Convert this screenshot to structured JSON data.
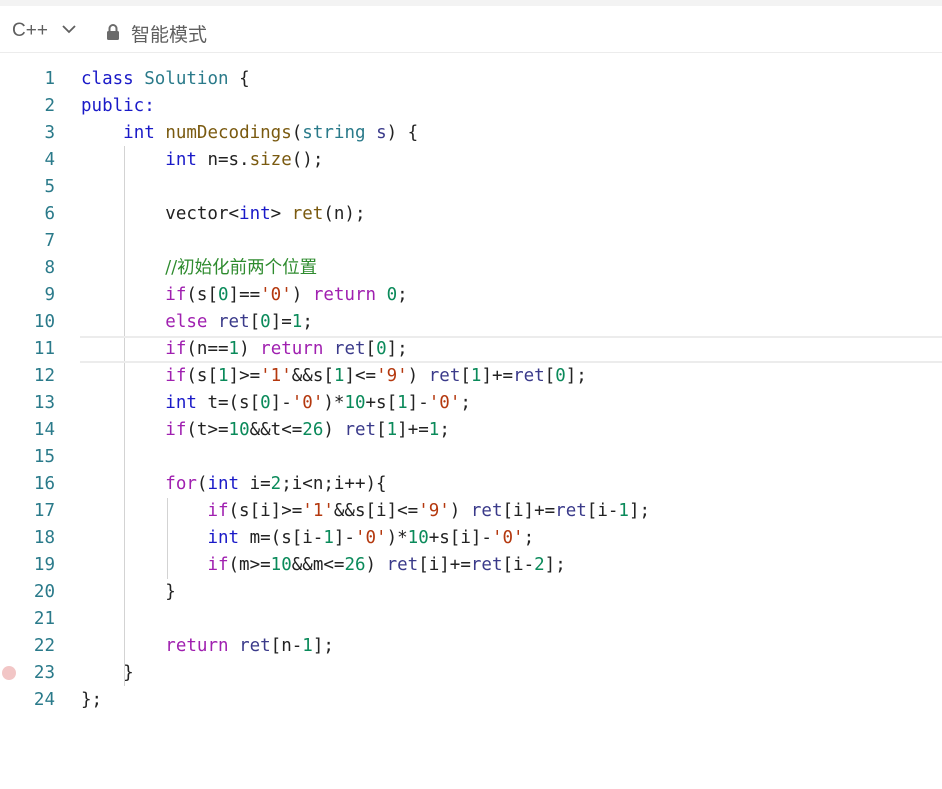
{
  "toolbar": {
    "language": "C++",
    "mode_label": "智能模式",
    "icons": {
      "lang_dropdown": "chevron-down-icon",
      "lock": "lock-icon"
    }
  },
  "editor": {
    "active_line": 11,
    "breakpoint_line": 23,
    "lines": [
      {
        "num": "1",
        "html": "<span class='k'>class</span> <span class='t'>Solution</span> {"
      },
      {
        "num": "2",
        "html": "<span class='k'>public:</span>"
      },
      {
        "num": "3",
        "html": "    <span class='k'>int</span> <span class='f'>numDecodings</span>(<span class='t'>string</span> <span class='m'>s</span>) {"
      },
      {
        "num": "4",
        "html": "        <span class='k'>int</span> n=s.<span class='f'>size</span>();"
      },
      {
        "num": "5",
        "html": ""
      },
      {
        "num": "6",
        "html": "        vector&lt;<span class='k'>int</span>&gt; <span class='f'>ret</span>(n);"
      },
      {
        "num": "7",
        "html": ""
      },
      {
        "num": "8",
        "html": "        <span class='cm'>//初始化前两个位置</span>"
      },
      {
        "num": "9",
        "html": "        <span class='c'>if</span>(s[<span class='n'>0</span>]==<span class='s'>'0'</span>) <span class='c'>return</span> <span class='n'>0</span>;"
      },
      {
        "num": "10",
        "html": "        <span class='c'>else</span> <span class='m'>ret</span>[<span class='n'>0</span>]=<span class='n'>1</span>;"
      },
      {
        "num": "11",
        "html": "        <span class='c'>if</span>(n==<span class='n'>1</span>) <span class='c'>return</span> <span class='m'>ret</span>[<span class='n'>0</span>];"
      },
      {
        "num": "12",
        "html": "        <span class='c'>if</span>(s[<span class='n'>1</span>]&gt;=<span class='s'>'1'</span>&amp;&amp;s[<span class='n'>1</span>]&lt;=<span class='s'>'9'</span>) <span class='m'>ret</span>[<span class='n'>1</span>]+=<span class='m'>ret</span>[<span class='n'>0</span>];"
      },
      {
        "num": "13",
        "html": "        <span class='k'>int</span> t=(s[<span class='n'>0</span>]-<span class='s'>'0'</span>)*<span class='n'>10</span>+s[<span class='n'>1</span>]-<span class='s'>'0'</span>;"
      },
      {
        "num": "14",
        "html": "        <span class='c'>if</span>(t&gt;=<span class='n'>10</span>&amp;&amp;t&lt;=<span class='n'>26</span>) <span class='m'>ret</span>[<span class='n'>1</span>]+=<span class='n'>1</span>;"
      },
      {
        "num": "15",
        "html": ""
      },
      {
        "num": "16",
        "html": "        <span class='c'>for</span>(<span class='k'>int</span> i=<span class='n'>2</span>;i&lt;n;i++){"
      },
      {
        "num": "17",
        "html": "            <span class='c'>if</span>(s[i]&gt;=<span class='s'>'1'</span>&amp;&amp;s[i]&lt;=<span class='s'>'9'</span>) <span class='m'>ret</span>[i]+=<span class='m'>ret</span>[i-<span class='n'>1</span>];"
      },
      {
        "num": "18",
        "html": "            <span class='k'>int</span> m=(s[i-<span class='n'>1</span>]-<span class='s'>'0'</span>)*<span class='n'>10</span>+s[i]-<span class='s'>'0'</span>;"
      },
      {
        "num": "19",
        "html": "            <span class='c'>if</span>(m&gt;=<span class='n'>10</span>&amp;&amp;m&lt;=<span class='n'>26</span>) <span class='m'>ret</span>[i]+=<span class='m'>ret</span>[i-<span class='n'>2</span>];"
      },
      {
        "num": "20",
        "html": "        }"
      },
      {
        "num": "21",
        "html": ""
      },
      {
        "num": "22",
        "html": "        <span class='c'>return</span> <span class='m'>ret</span>[n-<span class='n'>1</span>];"
      },
      {
        "num": "23",
        "html": "    }"
      },
      {
        "num": "24",
        "html": "};"
      }
    ]
  }
}
